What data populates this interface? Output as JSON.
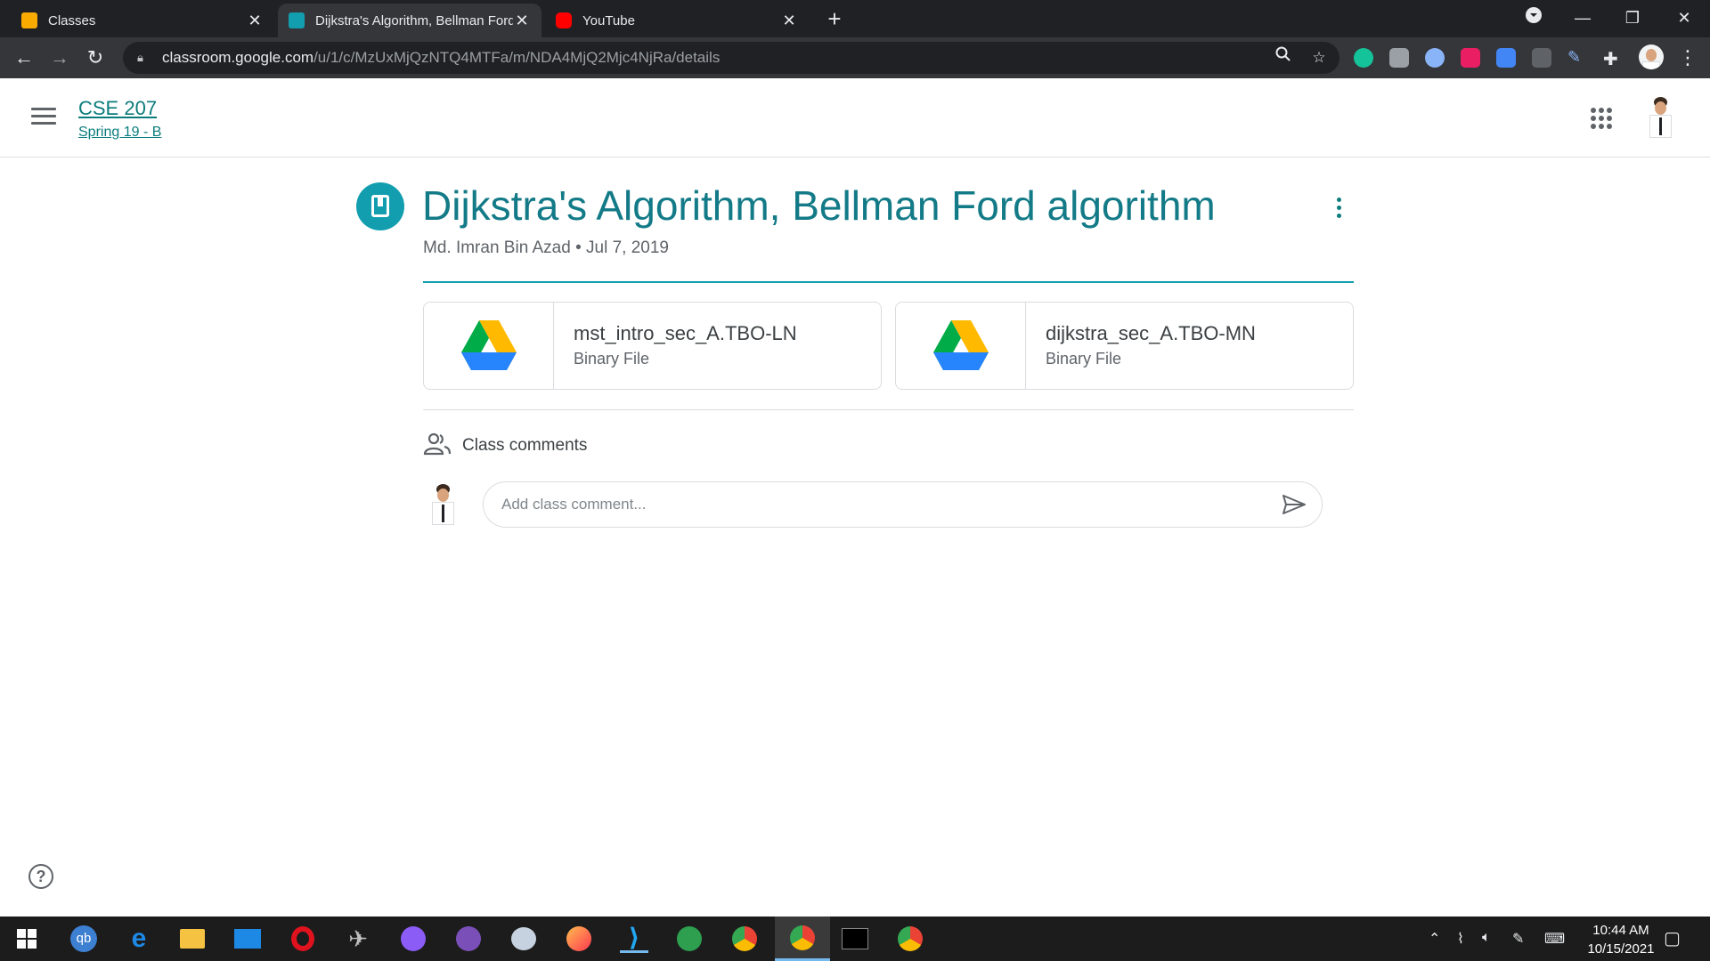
{
  "browser": {
    "tabs": [
      {
        "title": "Classes",
        "favicon_color": "#f9ab00"
      },
      {
        "title": "Dijkstra's Algorithm, Bellman Ford algorithm",
        "favicon_color": "#129eaf",
        "active": true
      },
      {
        "title": "YouTube",
        "favicon_color": "#ff0000"
      }
    ],
    "url_domain": "classroom.google.com",
    "url_path": "/u/1/c/MzUxMjQzNTQ4MTFa/m/NDA4MjQ2Mjc4NjRa/details"
  },
  "classroom": {
    "class_name": "CSE 207",
    "class_section": "Spring 19 - B",
    "post": {
      "title": "Dijkstra's Algorithm, Bellman Ford algorithm",
      "meta": "Md. Imran Bin Azad • Jul 7, 2019",
      "accent_color": "#0b7c7c"
    },
    "attachments": [
      {
        "name": "mst_intro_sec_A.TBO-LN",
        "type": "Binary File"
      },
      {
        "name": "dijkstra_sec_A.TBO-MN",
        "type": "Binary File"
      }
    ],
    "comments": {
      "label": "Class comments",
      "placeholder": "Add class comment..."
    }
  },
  "taskbar": {
    "time": "10:44 AM",
    "date": "10/15/2021"
  },
  "icons": [
    "search-icon",
    "star-icon",
    "extensions-icon",
    "apps-grid-icon",
    "help-icon",
    "send-icon",
    "people-icon",
    "google-drive-icon"
  ]
}
